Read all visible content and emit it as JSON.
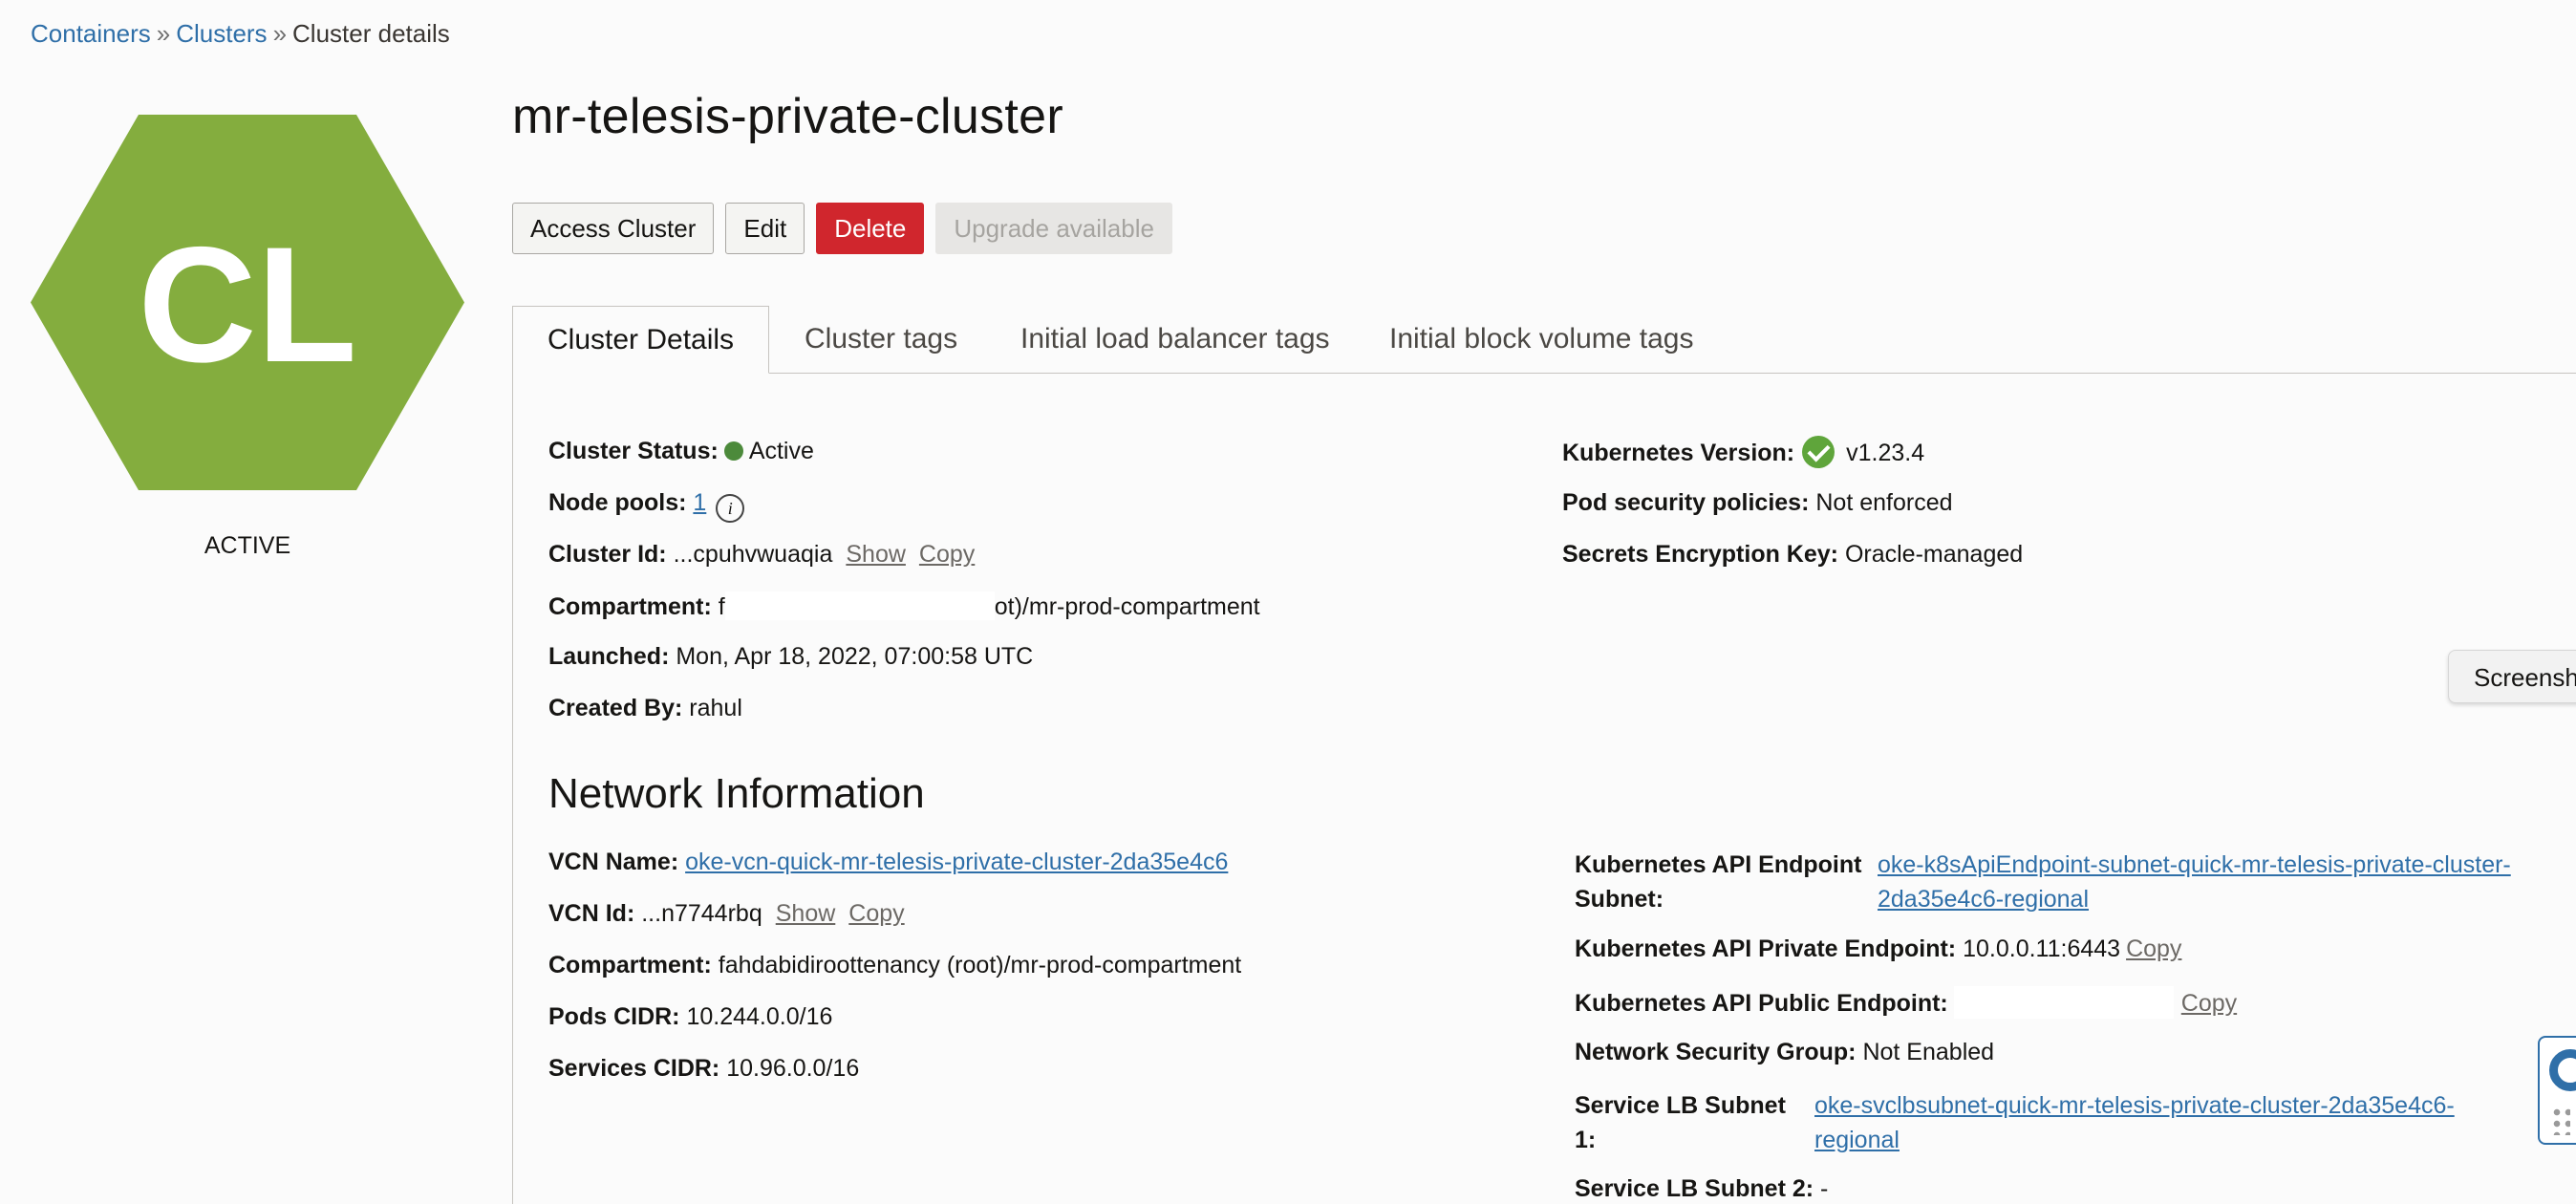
{
  "breadcrumb": {
    "containers": "Containers",
    "sep1": "»",
    "clusters": "Clusters",
    "sep2": "»",
    "current": "Cluster details"
  },
  "resource_icon": {
    "initials": "CL",
    "color": "#84ad3e",
    "status": "ACTIVE"
  },
  "title": "mr-telesis-private-cluster",
  "actions": {
    "access": "Access Cluster",
    "edit": "Edit",
    "delete": "Delete",
    "upgrade": "Upgrade available"
  },
  "tabs": [
    "Cluster Details",
    "Cluster tags",
    "Initial load balancer tags",
    "Initial block volume tags"
  ],
  "details": {
    "status_label": "Cluster Status:",
    "status_value": "Active",
    "node_pools_label": "Node pools:",
    "node_pools_value": "1",
    "cluster_id_label": "Cluster Id:",
    "cluster_id_value": "...cpuhvwuaqia",
    "compartment_label": "Compartment:",
    "compartment_prefix": "f",
    "compartment_suffix": "ot)/mr-prod-compartment",
    "launched_label": "Launched:",
    "launched_value": "Mon, Apr 18, 2022, 07:00:58 UTC",
    "created_by_label": "Created By:",
    "created_by_value": "rahul",
    "k8s_version_label": "Kubernetes Version:",
    "k8s_version_value": "v1.23.4",
    "pod_security_label": "Pod security policies:",
    "pod_security_value": "Not enforced",
    "secrets_label": "Secrets Encryption Key:",
    "secrets_value": "Oracle-managed",
    "show": "Show",
    "copy": "Copy"
  },
  "network": {
    "title": "Network Information",
    "vcn_name_label": "VCN Name:",
    "vcn_name_value": "oke-vcn-quick-mr-telesis-private-cluster-2da35e4c6",
    "vcn_id_label": "VCN Id:",
    "vcn_id_value": "...n7744rbq",
    "compartment_label": "Compartment:",
    "compartment_value": "fahdabidiroottenancy (root)/mr-prod-compartment",
    "pods_cidr_label": "Pods CIDR:",
    "pods_cidr_value": "10.244.0.0/16",
    "services_cidr_label": "Services CIDR:",
    "services_cidr_value": "10.96.0.0/16",
    "api_subnet_label_1": "Kubernetes API Endpoint",
    "api_subnet_label_2": "Subnet:",
    "api_subnet_value_1": "oke-k8sApiEndpoint-subnet-quick-mr-telesis-private-cluster-",
    "api_subnet_value_2": "2da35e4c6-regional",
    "private_endpoint_label": "Kubernetes API Private Endpoint:",
    "private_endpoint_value": "10.0.0.11:6443",
    "public_endpoint_label": "Kubernetes API Public Endpoint:",
    "nsg_label": "Network Security Group:",
    "nsg_value": "Not Enabled",
    "lb1_label_1": "Service LB Subnet",
    "lb1_label_2": "1:",
    "lb1_value_1": "oke-svclbsubnet-quick-mr-telesis-private-cluster-2da35e4c6-",
    "lb1_value_2": "regional",
    "lb2_label": "Service LB Subnet 2:",
    "lb2_value": "-"
  },
  "overlay": {
    "screenshot_button": "Screensh",
    "help_icon": "lifebuoy-icon"
  }
}
